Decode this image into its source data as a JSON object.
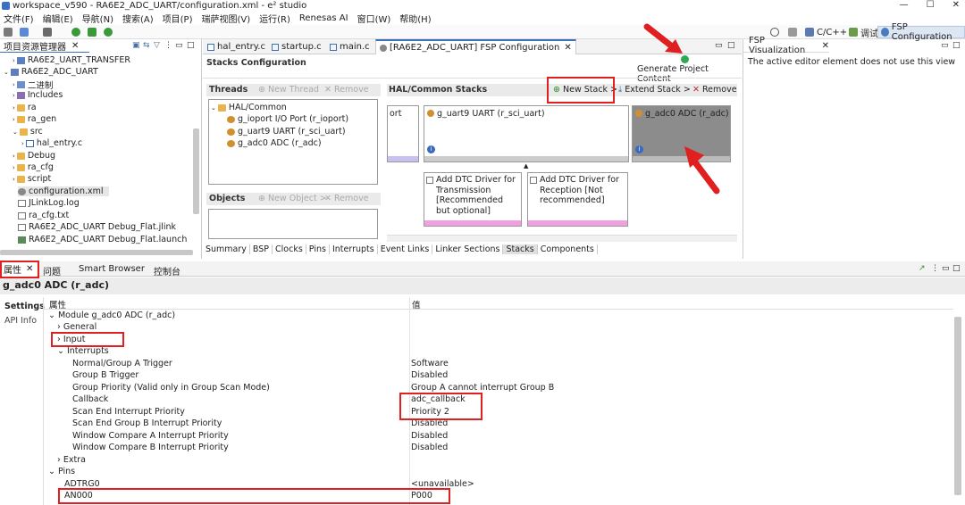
{
  "window": {
    "title": "workspace_v590 - RA6E2_ADC_UART/configuration.xml - e² studio",
    "min": "—",
    "max": "☐",
    "close": "✕"
  },
  "menu": [
    "文件(F)",
    "编辑(E)",
    "导航(N)",
    "搜索(A)",
    "项目(P)",
    "瑞萨视图(V)",
    "运行(R)",
    "Renesas AI",
    "窗口(W)",
    "帮助(H)"
  ],
  "perspectives": [
    {
      "label": "C/C++"
    },
    {
      "label": "调试"
    },
    {
      "label": "FSP Configuration"
    }
  ],
  "project_explorer": {
    "tab": "项目资源管理器",
    "items": [
      {
        "label": "RA6E2_UART_TRANSFER"
      },
      {
        "label": "RA6E2_ADC_UART"
      },
      {
        "label": "二进制"
      },
      {
        "label": "Includes"
      },
      {
        "label": "ra"
      },
      {
        "label": "ra_gen"
      },
      {
        "label": "src"
      },
      {
        "label": "hal_entry.c"
      },
      {
        "label": "Debug"
      },
      {
        "label": "ra_cfg"
      },
      {
        "label": "script"
      },
      {
        "label": "configuration.xml"
      },
      {
        "label": "JLinkLog.log"
      },
      {
        "label": "ra_cfg.txt"
      },
      {
        "label": "RA6E2_ADC_UART Debug_Flat.jlink"
      },
      {
        "label": "RA6E2_ADC_UART Debug_Flat.launch"
      }
    ]
  },
  "editor_tabs": [
    {
      "label": "hal_entry.c"
    },
    {
      "label": "startup.c"
    },
    {
      "label": "main.c"
    },
    {
      "label": "[RA6E2_ADC_UART] FSP Configuration"
    }
  ],
  "fsp": {
    "stacks_configuration": "Stacks Configuration",
    "generate": "Generate Project Content",
    "threads_title": "Threads",
    "new_thread": "New Thread",
    "remove": "Remove",
    "threads": {
      "root": "HAL/Common",
      "items": [
        "g_ioport I/O Port (r_ioport)",
        "g_uart9 UART (r_sci_uart)",
        "g_adc0 ADC (r_adc)"
      ]
    },
    "objects_title": "Objects",
    "new_object": "New Object >",
    "hal_stacks_title": "HAL/Common Stacks",
    "new_stack": "New Stack >",
    "extend_stack": "Extend Stack >",
    "remove_stack": "Remove",
    "stack_partial": "ort",
    "stack_uart": "g_uart9 UART (r_sci_uart)",
    "stack_adc": "g_adc0 ADC (r_adc)",
    "dtc_tx": "Add DTC Driver for Transmission [Recommended but optional]",
    "dtc_rx": "Add DTC Driver for Reception [Not recommended]",
    "bottom_tabs": [
      "Summary",
      "BSP",
      "Clocks",
      "Pins",
      "Interrupts",
      "Event Links",
      "Linker Sections",
      "Stacks",
      "Components"
    ]
  },
  "visualization": {
    "tab": "FSP Visualization",
    "text": "The active editor element does not use this view"
  },
  "properties_panel": {
    "tabs": [
      {
        "label": "属性"
      },
      {
        "label": "问题"
      },
      {
        "label": "Smart Browser"
      },
      {
        "label": "控制台"
      }
    ],
    "title": "g_adc0 ADC (r_adc)",
    "side_tabs": [
      "Settings",
      "API Info"
    ],
    "col_key": "属性",
    "col_val": "值",
    "rows": [
      {
        "k": "Module g_adc0 ADC (r_adc)",
        "v": ""
      },
      {
        "k": "General",
        "v": ""
      },
      {
        "k": "Input",
        "v": ""
      },
      {
        "k": "Interrupts",
        "v": ""
      },
      {
        "k": "Normal/Group A Trigger",
        "v": "Software"
      },
      {
        "k": "Group B Trigger",
        "v": "Disabled"
      },
      {
        "k": "Group Priority (Valid only in Group Scan Mode)",
        "v": "Group A cannot interrupt Group B"
      },
      {
        "k": "Callback",
        "v": "adc_callback"
      },
      {
        "k": "Scan End Interrupt Priority",
        "v": "Priority 2"
      },
      {
        "k": "Scan End Group B Interrupt Priority",
        "v": "Disabled"
      },
      {
        "k": "Window Compare A Interrupt Priority",
        "v": "Disabled"
      },
      {
        "k": "Window Compare B Interrupt Priority",
        "v": "Disabled"
      },
      {
        "k": "Extra",
        "v": ""
      },
      {
        "k": "Pins",
        "v": ""
      },
      {
        "k": "ADTRG0",
        "v": "<unavailable>"
      },
      {
        "k": "AN000",
        "v": "P000"
      }
    ]
  }
}
